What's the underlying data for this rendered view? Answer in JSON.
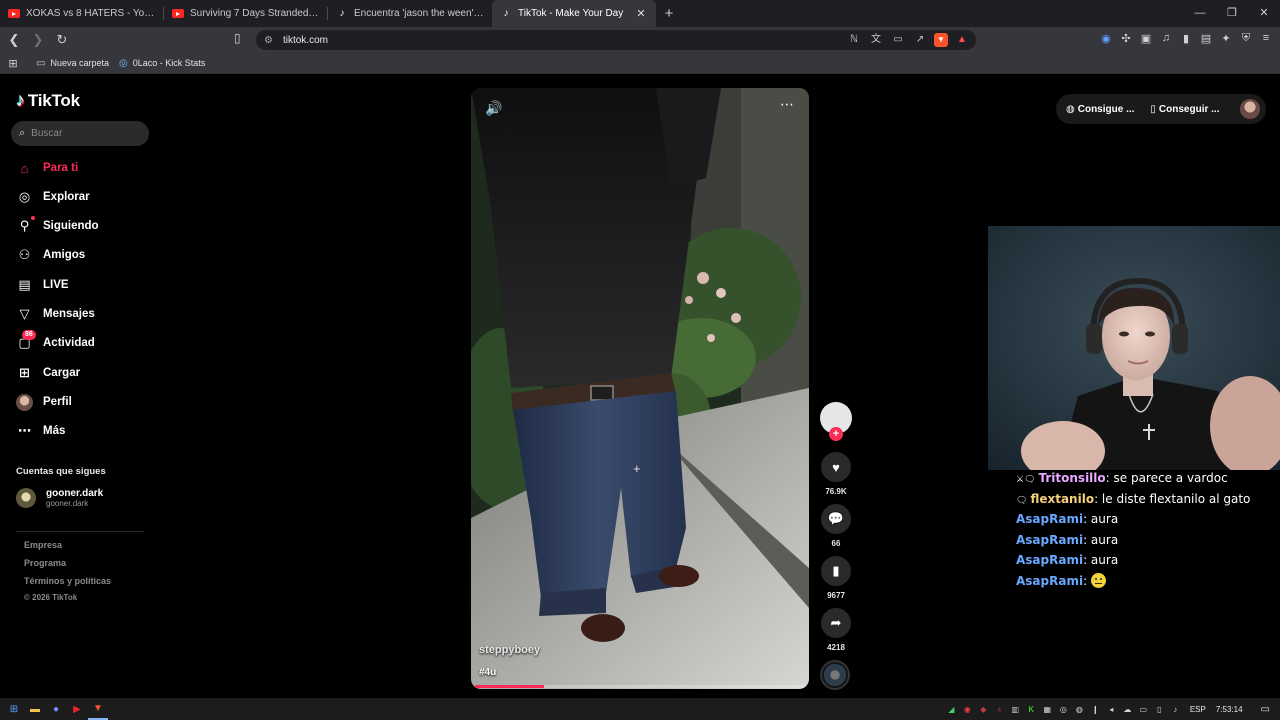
{
  "browser": {
    "tabs": [
      {
        "title": "XOKAS vs 8 HATERS - YouTube",
        "favicon": "youtube-icon",
        "active": false
      },
      {
        "title": "Surviving 7 Days Stranded On An Isla",
        "favicon": "youtube-icon",
        "active": false
      },
      {
        "title": "Encuentra 'jason the ween' en TikTok",
        "favicon": "tiktok-icon",
        "active": false
      },
      {
        "title": "TikTok - Make Your Day",
        "favicon": "tiktok-icon",
        "active": true
      }
    ],
    "url": "tiktok.com",
    "bookmarks": [
      {
        "label": "Nueva carpeta",
        "icon": "folder-icon"
      },
      {
        "label": "0Laco - Kick Stats",
        "icon": "kick-stats-icon"
      }
    ]
  },
  "tiktok": {
    "logo_text": "TikTok",
    "search_placeholder": "Buscar",
    "nav": [
      {
        "label": "Para ti",
        "icon": "home-icon",
        "active": true
      },
      {
        "label": "Explorar",
        "icon": "compass-icon"
      },
      {
        "label": "Siguiendo",
        "icon": "following-icon",
        "dot": true
      },
      {
        "label": "Amigos",
        "icon": "friends-icon"
      },
      {
        "label": "LIVE",
        "icon": "live-icon"
      },
      {
        "label": "Mensajes",
        "icon": "messages-icon"
      },
      {
        "label": "Actividad",
        "icon": "activity-icon",
        "badge": "86"
      },
      {
        "label": "Cargar",
        "icon": "upload-icon"
      },
      {
        "label": "Perfil",
        "icon": "profile-avatar"
      },
      {
        "label": "Más",
        "icon": "more-icon"
      }
    ],
    "following_title": "Cuentas que sigues",
    "following": [
      {
        "name": "gooner.dark",
        "handle": "gooner.dark"
      }
    ],
    "footer_links": [
      "Empresa",
      "Programa",
      "Términos y políticas"
    ],
    "copyright": "© 2026 TikTok",
    "top_buttons": {
      "get_coins": "Consigue ...",
      "get_app": "Conseguir ..."
    },
    "video": {
      "author": "steppyboey",
      "caption": "#4u",
      "progress": 0.21
    },
    "actions": {
      "likes": "76.9K",
      "comments": "66",
      "saves": "9677",
      "shares": "4218"
    }
  },
  "chat": [
    {
      "prefix": "⚔🗨",
      "user": "Tritonsillo",
      "user_color": "#e8a8ff",
      "message": ": se parece a vardoc"
    },
    {
      "prefix": "🗨",
      "user": "flextanilo",
      "user_color": "#f6cf7a",
      "message": ": le diste flextanilo al gato"
    },
    {
      "prefix": "",
      "user": "AsapRami",
      "user_color": "#6aa7ff",
      "message": ": aura"
    },
    {
      "prefix": "",
      "user": "AsapRami",
      "user_color": "#6aa7ff",
      "message": ": aura"
    },
    {
      "prefix": "",
      "user": "AsapRami",
      "user_color": "#6aa7ff",
      "message": ": aura"
    },
    {
      "prefix": "",
      "user": "AsapRami",
      "user_color": "#6aa7ff",
      "message": ": ",
      "emoji": "neutral-face-emoji"
    }
  ],
  "taskbar": {
    "language": "ESP",
    "time": "7:53:14"
  },
  "colors": {
    "tiktok_red": "#fe2c55",
    "browser_dark": "#1f1f23",
    "browser_toolbar": "#36363d"
  }
}
